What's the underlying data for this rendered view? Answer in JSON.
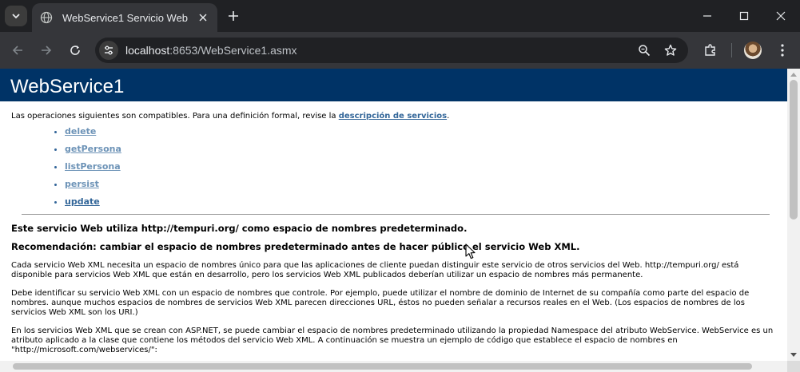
{
  "browser": {
    "tab_title": "WebService1 Servicio Web",
    "url_host": "localhost",
    "url_rest": ":8653/WebService1.asmx",
    "icons": [
      "tab-search-icon",
      "globe-icon",
      "close-icon",
      "plus-icon",
      "minimize-icon",
      "maximize-icon",
      "window-close-icon",
      "back-arrow-icon",
      "forward-arrow-icon",
      "reload-icon",
      "site-info-icon",
      "zoom-icon",
      "star-icon",
      "extensions-icon",
      "avatar",
      "kebab-menu-icon"
    ]
  },
  "page": {
    "title": "WebService1",
    "intro_text": "Las operaciones siguientes son compatibles. Para una definición formal, revise la ",
    "intro_link": "descripción de servicios",
    "intro_end": ".",
    "operations": [
      {
        "label": "delete"
      },
      {
        "label": "getPersona"
      },
      {
        "label": "listPersona"
      },
      {
        "label": "persist"
      },
      {
        "label": "update"
      }
    ],
    "namespace_notice": "Este servicio Web utiliza http://tempuri.org/ como espacio de nombres predeterminado.",
    "recommendation": "Recomendación: cambiar el espacio de nombres predeterminado antes de hacer público el servicio Web XML.",
    "para1": "Cada servicio Web XML necesita un espacio de nombres único para que las aplicaciones de cliente puedan distinguir este servicio de otros servicios del Web. http://tempuri.org/ está disponible para servicios Web XML que están en desarrollo, pero los servicios Web XML publicados deberían utilizar un espacio de nombres más permanente.",
    "para2": "Debe identificar su servicio Web XML con un espacio de nombres que controle. Por ejemplo, puede utilizar el nombre de dominio de Internet de su compañía como parte del espacio de nombres. aunque muchos espacios de nombres de servicios Web XML parecen direcciones URL, éstos no pueden señalar a recursos reales en el Web. (Los espacios de nombres de los servicios Web XML son los URI.)",
    "para3": "En los servicios Web XML que se crean con ASP.NET, se puede cambiar el espacio de nombres predeterminado utilizando la propiedad Namespace del atributo WebService. WebService es un atributo aplicado a la clase que contiene los métodos del servicio Web XML. A continuación se muestra un ejemplo de código que establece el espacio de nombres en \"http://microsoft.com/webservices/\":"
  },
  "colors": {
    "header_bg": "#003366",
    "link": "#336699",
    "link_unvisited": "#6d93b7"
  }
}
